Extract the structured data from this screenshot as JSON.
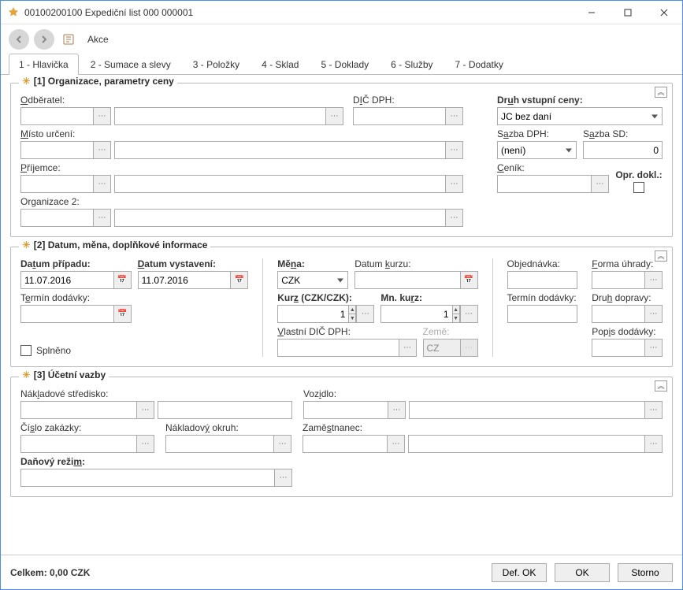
{
  "window": {
    "title": "00100200100  Expediční list  000 000001"
  },
  "toolbar": {
    "actions": "Akce"
  },
  "tabs": [
    {
      "label": "1 - Hlavička",
      "active": true
    },
    {
      "label": "2 - Sumace a slevy"
    },
    {
      "label": "3 - Položky"
    },
    {
      "label": "4 - Sklad"
    },
    {
      "label": "5 - Doklady"
    },
    {
      "label": "6 - Služby"
    },
    {
      "label": "7 - Dodatky"
    }
  ],
  "group1": {
    "legend": "[1] Organizace, parametry ceny",
    "labels": {
      "odberatel": "Odběratel:",
      "dic": "DIČ DPH:",
      "druh_ceny": "Druh vstupní ceny:",
      "misto": "Místo určení:",
      "sazba_dph": "Sazba DPH:",
      "sazba_sd": "Sazba SD:",
      "prijemce": "Příjemce:",
      "cenik": "Ceník:",
      "opr_dokl": "Opr. dokl.:",
      "org2": "Organizace 2:"
    },
    "values": {
      "odberatel_code": "",
      "odberatel_name": "",
      "dic": "",
      "druh_ceny": "JC bez daní",
      "misto_code": "",
      "misto_name": "",
      "sazba_dph": "(není)",
      "sazba_sd": "0",
      "prijemce_code": "",
      "prijemce_name": "",
      "cenik": "",
      "opr_dokl": false,
      "org2_code": "",
      "org2_name": ""
    }
  },
  "group2": {
    "legend": "[2] Datum, měna, doplňkové informace",
    "labels": {
      "datum_pripadu": "Datum případu:",
      "datum_vystaveni": "Datum vystavení:",
      "mena": "Měna:",
      "datum_kurzu": "Datum kurzu:",
      "objednavka": "Objednávka:",
      "forma_uhrady": "Forma úhrady:",
      "termin_dodavky": "Termín dodávky:",
      "kurz": "Kurz (CZK/CZK):",
      "mn_kurz": "Mn. kurz:",
      "termin_dodavky2": "Termín dodávky:",
      "druh_dopravy": "Druh dopravy:",
      "vlastni_dic": "Vlastní DIČ DPH:",
      "zeme": "Země:",
      "popis_dodavky": "Popis dodávky:",
      "splneno": "Splněno"
    },
    "values": {
      "datum_pripadu": "11.07.2016",
      "datum_vystaveni": "11.07.2016",
      "mena": "CZK",
      "datum_kurzu": "",
      "objednavka": "",
      "forma_uhrady": "",
      "termin_dodavky": "",
      "kurz": "1",
      "mn_kurz": "1",
      "termin_dodavky2": "",
      "druh_dopravy": "",
      "vlastni_dic": "",
      "zeme": "CZ",
      "popis_dodavky": "",
      "splneno": false
    }
  },
  "group3": {
    "legend": "[3] Účetní vazby",
    "labels": {
      "nakl_stredisko": "Nákladové středisko:",
      "vozidlo": "Vozidlo:",
      "cislo_zakazky": "Číslo zakázky:",
      "nakl_okruh": "Nákladový okruh:",
      "zamestnanec": "Zaměstnanec:",
      "danovy_rezim": "Daňový režim:"
    },
    "values": {
      "nakl_stredisko": "",
      "nakl_stredisko_name": "",
      "vozidlo": "",
      "vozidlo_name": "",
      "cislo_zakazky": "",
      "nakl_okruh": "",
      "zamestnanec": "",
      "zamestnanec_name": "",
      "danovy_rezim": ""
    }
  },
  "footer": {
    "total": "Celkem: 0,00 CZK",
    "def_ok": "Def. OK",
    "ok": "OK",
    "storno": "Storno"
  }
}
